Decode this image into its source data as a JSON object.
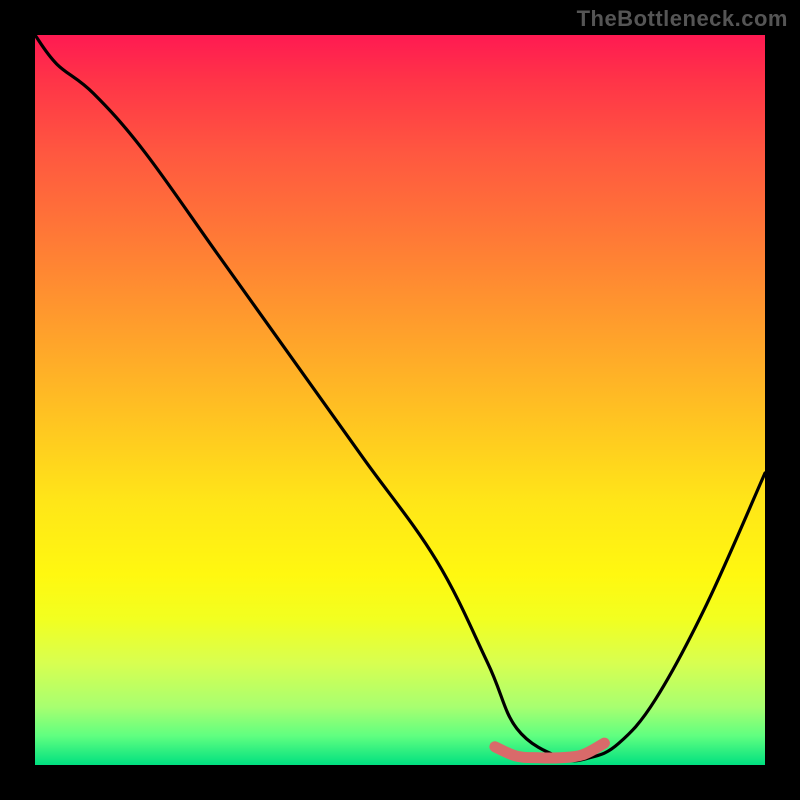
{
  "watermark": "TheBottleneck.com",
  "colors": {
    "frame_bg": "#000000",
    "curve_main": "#000000",
    "curve_marker": "#d96a6a",
    "watermark_text": "#555555"
  },
  "chart_data": {
    "type": "line",
    "title": "",
    "xlabel": "",
    "ylabel": "",
    "xlim": [
      0,
      100
    ],
    "ylim": [
      0,
      100
    ],
    "grid": false,
    "legend": false,
    "annotations": [],
    "series": [
      {
        "name": "bottleneck-curve",
        "x": [
          0,
          3,
          8,
          15,
          25,
          35,
          45,
          55,
          62,
          66,
          72,
          76,
          80,
          85,
          92,
          100
        ],
        "y": [
          100,
          96,
          92,
          84,
          70,
          56,
          42,
          28,
          14,
          5,
          1,
          1,
          3,
          9,
          22,
          40
        ]
      },
      {
        "name": "optimal-range-marker",
        "x": [
          63,
          66,
          69,
          72,
          75,
          78
        ],
        "y": [
          2.5,
          1.2,
          1.0,
          1.0,
          1.4,
          3.0
        ]
      }
    ]
  }
}
